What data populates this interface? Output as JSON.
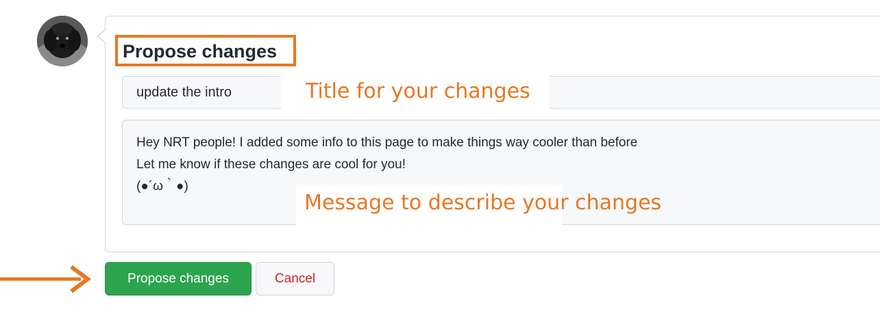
{
  "avatar": {
    "icon": "user-avatar-photo"
  },
  "form": {
    "heading": "Propose changes",
    "title_value": "update the intro",
    "body_lines": [
      "Hey NRT people! I added some info to this page to make things way cooler than before",
      "Let me know if these changes are cool for you!",
      "(●´ω｀●)"
    ]
  },
  "annotations": {
    "title_label": "Title for your changes",
    "message_label": "Message to describe your changes",
    "color": "#e87722"
  },
  "buttons": {
    "propose_label": "Propose changes",
    "cancel_label": "Cancel"
  },
  "colors": {
    "primary_button": "#2da44e",
    "cancel_text": "#cf222e",
    "highlight": "#e87722"
  }
}
